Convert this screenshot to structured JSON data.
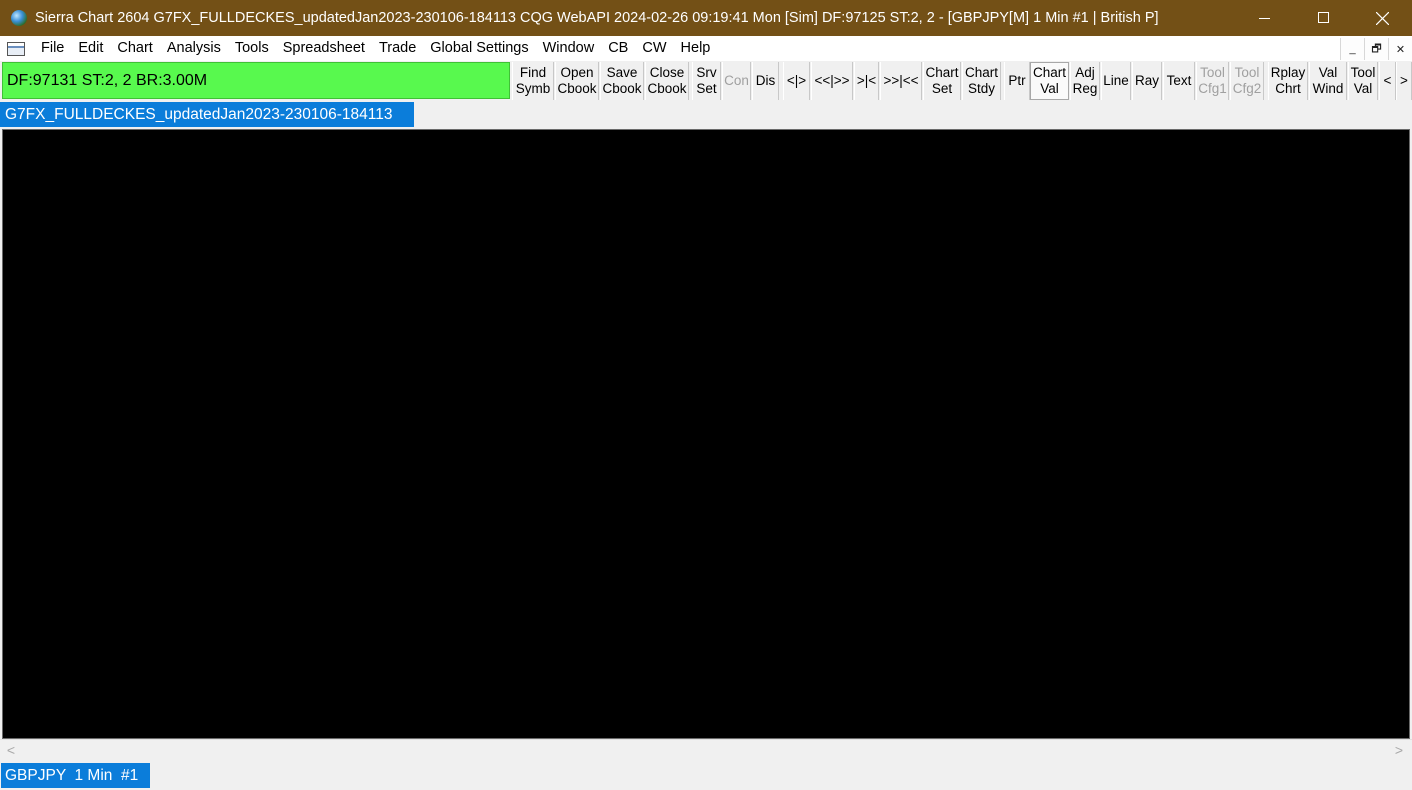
{
  "titlebar": {
    "title": "Sierra Chart 2604 G7FX_FULLDECKES_updatedJan2023-230106-184113 CQG WebAPI 2024-02-26  09:19:41 Mon [Sim] DF:97125  ST:2, 2 - [GBPJPY[M]  1 Min  #1 | British P]",
    "minimize": "—",
    "close": "✕"
  },
  "menubar": {
    "items": [
      "File",
      "Edit",
      "Chart",
      "Analysis",
      "Tools",
      "Spreadsheet",
      "Trade",
      "Global Settings",
      "Window",
      "CB",
      "CW",
      "Help"
    ],
    "mdi_minimize": "_",
    "mdi_restore": "🗗",
    "mdi_close": "✕"
  },
  "controlbar": {
    "status": "DF:97131  ST:2, 2  BR:3.00M",
    "buttons": [
      {
        "l1": "Find",
        "l2": "Symb"
      },
      {
        "l1": "Open",
        "l2": "Cbook"
      },
      {
        "l1": "Save",
        "l2": "Cbook"
      },
      {
        "l1": "Close",
        "l2": "Cbook"
      },
      {
        "l1": "Srv",
        "l2": "Set"
      },
      {
        "l1": "Con",
        "l2": ""
      },
      {
        "l1": "Dis",
        "l2": ""
      },
      {
        "l1": "<|>",
        "l2": ""
      },
      {
        "l1": "<<|>>",
        "l2": ""
      },
      {
        "l1": ">|<",
        "l2": ""
      },
      {
        "l1": ">>|<<",
        "l2": ""
      },
      {
        "l1": "Chart",
        "l2": "Set"
      },
      {
        "l1": "Chart",
        "l2": "Stdy"
      },
      {
        "l1": "Ptr",
        "l2": ""
      },
      {
        "l1": "Chart",
        "l2": "Val"
      },
      {
        "l1": "Adj",
        "l2": "Reg"
      },
      {
        "l1": "Line",
        "l2": ""
      },
      {
        "l1": "Ray",
        "l2": ""
      },
      {
        "l1": "Text",
        "l2": ""
      },
      {
        "l1": "Tool",
        "l2": "Cfg1"
      },
      {
        "l1": "Tool",
        "l2": "Cfg2"
      },
      {
        "l1": "Rplay",
        "l2": "Chrt"
      },
      {
        "l1": "Val",
        "l2": "Wind"
      },
      {
        "l1": "Tool",
        "l2": "Val"
      },
      {
        "l1": "<",
        "l2": ""
      },
      {
        "l1": ">",
        "l2": ""
      }
    ]
  },
  "chartbook_tab": "G7FX_FULLDECKES_updatedJan2023-230106-184113",
  "scrollbar": {
    "left": "<",
    "right": ">"
  },
  "chart_tab": "GBPJPY  1 Min  #1"
}
